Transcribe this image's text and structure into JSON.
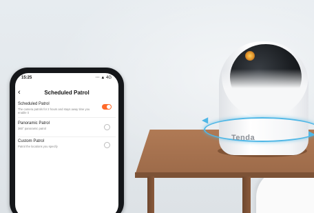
{
  "phone": {
    "status_bar": {
      "time": "15:25",
      "icons": "⋯ ▲ 4G"
    },
    "header": {
      "back_icon": "chevron-left-icon",
      "title": "Scheduled Patrol"
    },
    "options": [
      {
        "title": "Scheduled Patrol",
        "description": "The camera patrols for 2 hours and stays away time you enable it",
        "control": "toggle",
        "enabled": true
      },
      {
        "title": "Panoramic Patrol",
        "description": "360° panoramic patrol",
        "control": "radio",
        "selected": false
      },
      {
        "title": "Custom Patrol",
        "description": "Patrol the locations you specify",
        "control": "radio",
        "selected": false
      }
    ]
  },
  "camera": {
    "brand": "Tenda"
  },
  "colors": {
    "accent": "#ff6a2a",
    "ring": "#4fb7e6"
  }
}
